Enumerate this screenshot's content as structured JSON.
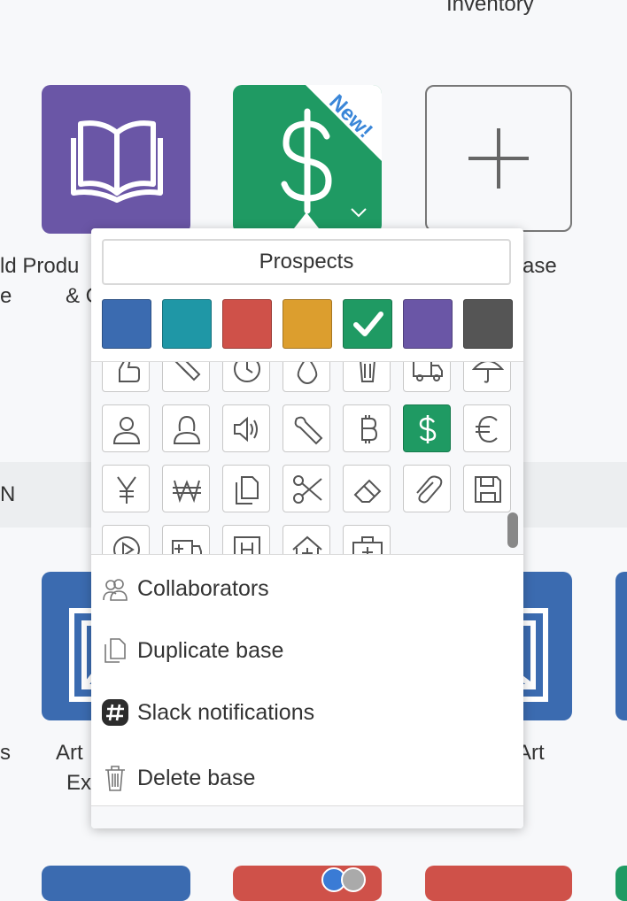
{
  "background_labels": {
    "top_right_partial": "Inventory",
    "left_row1_line1": "ld Produ",
    "left_row1_line2_a": "e",
    "left_row1_line2_b": "& C",
    "add_base_partial": "ase",
    "band_partial": "N",
    "row2_left_partial": "s",
    "row2_art_a_line1": "Art",
    "row2_art_a_line2": "Ex",
    "row2_art_b": "Art"
  },
  "popover": {
    "name_input_value": "Prospects",
    "colors": [
      {
        "name": "blue",
        "hex": "#3b6bb0"
      },
      {
        "name": "teal",
        "hex": "#1f97a6"
      },
      {
        "name": "red",
        "hex": "#cf5149"
      },
      {
        "name": "yellow",
        "hex": "#dc9e2e"
      },
      {
        "name": "green",
        "hex": "#1f9a63",
        "selected": true
      },
      {
        "name": "purple",
        "hex": "#6a56a6"
      },
      {
        "name": "gray",
        "hex": "#555555"
      }
    ],
    "menu": {
      "collaborators": "Collaborators",
      "duplicate": "Duplicate base",
      "slack": "Slack notifications",
      "delete": "Delete base"
    }
  },
  "tiles": {
    "prospects_badge": "New!",
    "colors": {
      "purple": "#6a56a6",
      "green": "#1f9a63",
      "blue": "#3b6bb0",
      "red": "#cf5149"
    }
  }
}
